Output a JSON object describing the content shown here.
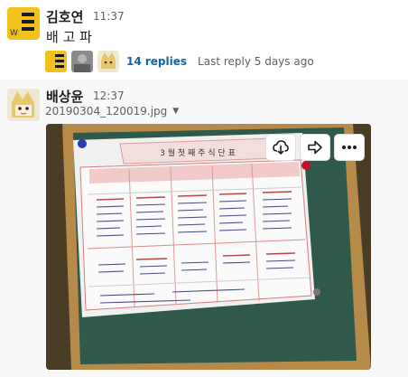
{
  "message1": {
    "sender": "김호연",
    "time": "11:37",
    "text": "배 고 파",
    "thread": {
      "replies": "14 replies",
      "last_reply": "Last reply 5 days ago"
    }
  },
  "message2": {
    "sender": "배상윤",
    "time": "12:37",
    "file_name": "20190304_120019.jpg",
    "actions": [
      "download",
      "share",
      "more"
    ]
  },
  "menu_board": {
    "title": "3 월 첫 째 주 식 단 표"
  }
}
